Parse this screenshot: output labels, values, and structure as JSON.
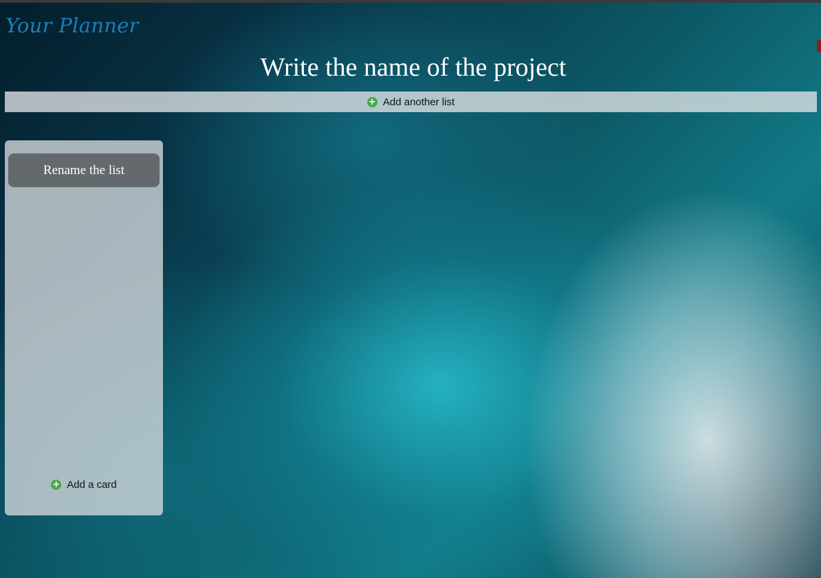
{
  "app": {
    "brand": "Your Planner"
  },
  "project": {
    "title": "Write the name of the project"
  },
  "toolbar": {
    "add_list_label": "Add another list",
    "add_icon": "plus-circle-icon"
  },
  "lists": [
    {
      "title": "Rename the list",
      "add_card_label": "Add a card"
    }
  ],
  "colors": {
    "brand": "#1b7fb8",
    "add_icon": "#4aa84d",
    "list_title_bg": "#5a5f62"
  }
}
